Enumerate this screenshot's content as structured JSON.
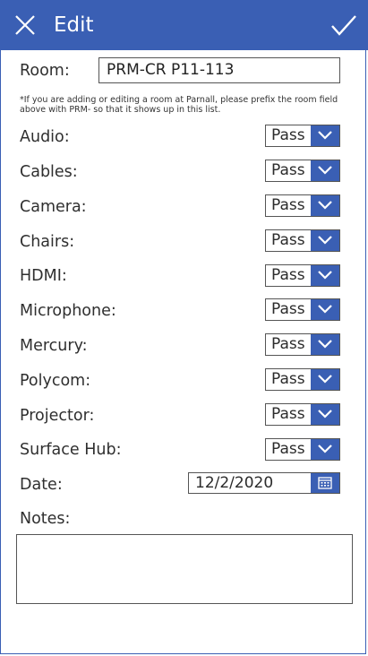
{
  "header": {
    "title": "Edit",
    "close_icon": "close-icon",
    "save_icon": "checkmark-icon",
    "accent": "#3a5fb4"
  },
  "room": {
    "label": "Room:",
    "value": "PRM-CR P11-113"
  },
  "note": "*If you are adding or editing a room at Parnall, please prefix the room field above with PRM- so that it shows up in this list.",
  "checks": [
    {
      "label": "Audio:",
      "value": "Pass"
    },
    {
      "label": "Cables:",
      "value": "Pass"
    },
    {
      "label": "Camera:",
      "value": "Pass"
    },
    {
      "label": "Chairs:",
      "value": "Pass"
    },
    {
      "label": "HDMI:",
      "value": "Pass"
    },
    {
      "label": "Microphone:",
      "value": "Pass"
    },
    {
      "label": "Mercury:",
      "value": "Pass"
    },
    {
      "label": "Polycom:",
      "value": "Pass"
    },
    {
      "label": "Projector:",
      "value": "Pass"
    },
    {
      "label": "Surface Hub:",
      "value": "Pass"
    }
  ],
  "date": {
    "label": "Date:",
    "value": "12/2/2020",
    "icon": "calendar-icon"
  },
  "notes": {
    "label": "Notes:",
    "value": ""
  }
}
